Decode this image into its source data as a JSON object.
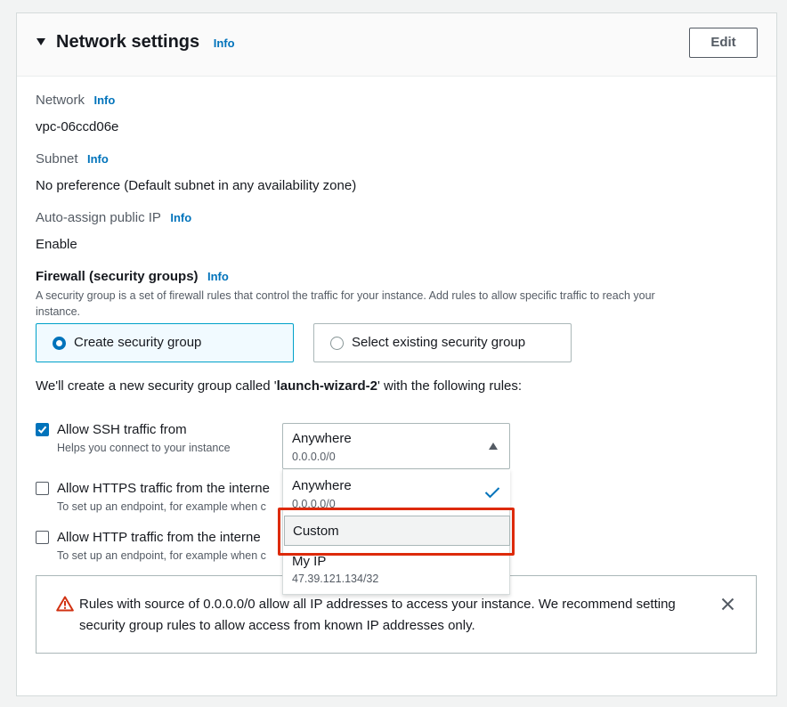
{
  "panel": {
    "title": "Network settings",
    "info": "Info",
    "edit_label": "Edit"
  },
  "network": {
    "label": "Network",
    "info": "Info",
    "value": "vpc-06ccd06e"
  },
  "subnet": {
    "label": "Subnet",
    "info": "Info",
    "value": "No preference (Default subnet in any availability zone)"
  },
  "public_ip": {
    "label": "Auto-assign public IP",
    "info": "Info",
    "value": "Enable"
  },
  "firewall": {
    "label": "Firewall (security groups)",
    "info": "Info",
    "description_line1": "A security group is a set of firewall rules that control the traffic for your instance. Add rules to allow specific traffic to reach your",
    "description_line2": "instance.",
    "options": [
      {
        "label": "Create security group",
        "selected": true
      },
      {
        "label": "Select existing security group",
        "selected": false
      }
    ],
    "intro_prefix": "We'll create a new security group called '",
    "group_name": "launch-wizard-2",
    "intro_suffix": "' with the following rules:"
  },
  "rules": [
    {
      "label": "Allow SSH traffic from",
      "description": "Helps you connect to your instance",
      "checked": true
    },
    {
      "label": "Allow HTTPS traffic from the interne",
      "description": "To set up an endpoint, for example when c",
      "checked": false
    },
    {
      "label": "Allow HTTP traffic from the interne",
      "description": "To set up an endpoint, for example when c",
      "checked": false
    }
  ],
  "ssh_source": {
    "selected_label": "Anywhere",
    "selected_sub": "0.0.0.0/0",
    "options": [
      {
        "label": "Anywhere",
        "sub": "0.0.0.0/0",
        "selected": true
      },
      {
        "label": "Custom",
        "sub": "",
        "highlighted": true
      },
      {
        "label": "My IP",
        "sub": "47.39.121.134/32"
      }
    ]
  },
  "warning": {
    "line1": "Rules with source of 0.0.0.0/0 allow all IP addresses to access your instance. We recommend setting",
    "line2": "security group rules to allow access from known IP addresses only."
  },
  "colors": {
    "accent": "#0073bb",
    "warning": "#d13212",
    "highlight_box": "#dd2a0a"
  }
}
